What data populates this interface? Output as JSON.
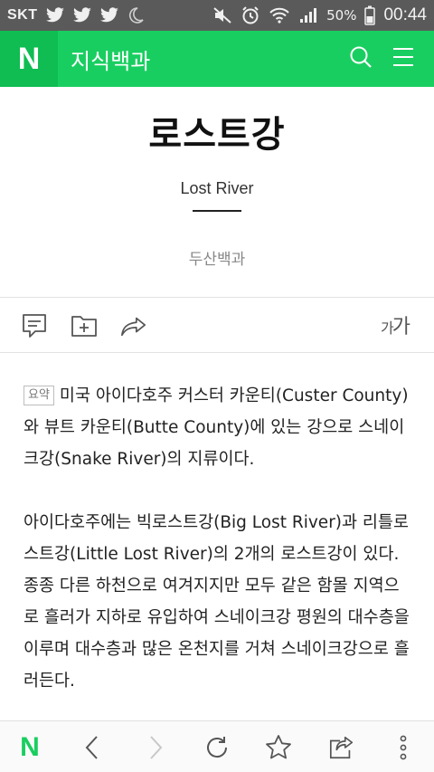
{
  "status_bar": {
    "carrier": "SKT",
    "battery": "50%",
    "time": "00:44",
    "icons": [
      "twitter-icon",
      "twitter-icon",
      "twitter-icon",
      "moon-icon",
      "mute-icon",
      "alarm-icon",
      "wifi-icon",
      "signal-icon",
      "battery-icon"
    ]
  },
  "header": {
    "logo": "N",
    "title": "지식백과",
    "actions": [
      "search-icon",
      "menu-icon"
    ]
  },
  "entry": {
    "title": "로스트강",
    "subtitle": "Lost River",
    "source": "두산백과"
  },
  "toolbar": {
    "icons": [
      "comment-icon",
      "folder-add-icon",
      "share-icon"
    ],
    "font_size_label_small": "가",
    "font_size_label_large": "가"
  },
  "content": {
    "summary_badge": "요약",
    "summary": "미국 아이다호주 커스터 카운티(Custer County)와 뷰트 카운티(Butte County)에 있는 강으로 스네이크강(Snake River)의 지류이다.",
    "paragraph": "아이다호주에는 빅로스트강(Big Lost River)과 리틀로스트강(Little Lost River)의 2개의 로스트강이 있다. 종종 다른 하천으로 여겨지지만 모두 같은 함몰 지역으로 흘러가 지하로 유입하여 스네이크강 평원의 대수층을 이루며 대수층과 많은 온천지를 거쳐 스네이크강으로 흘러든다."
  },
  "bottom_nav": {
    "home_label": "N",
    "icons": [
      "back-icon",
      "forward-icon",
      "refresh-icon",
      "bookmark-star-icon",
      "share-out-icon",
      "more-icon"
    ]
  },
  "colors": {
    "brand_green": "#19ce60",
    "status_bar": "#5a5a5a"
  }
}
